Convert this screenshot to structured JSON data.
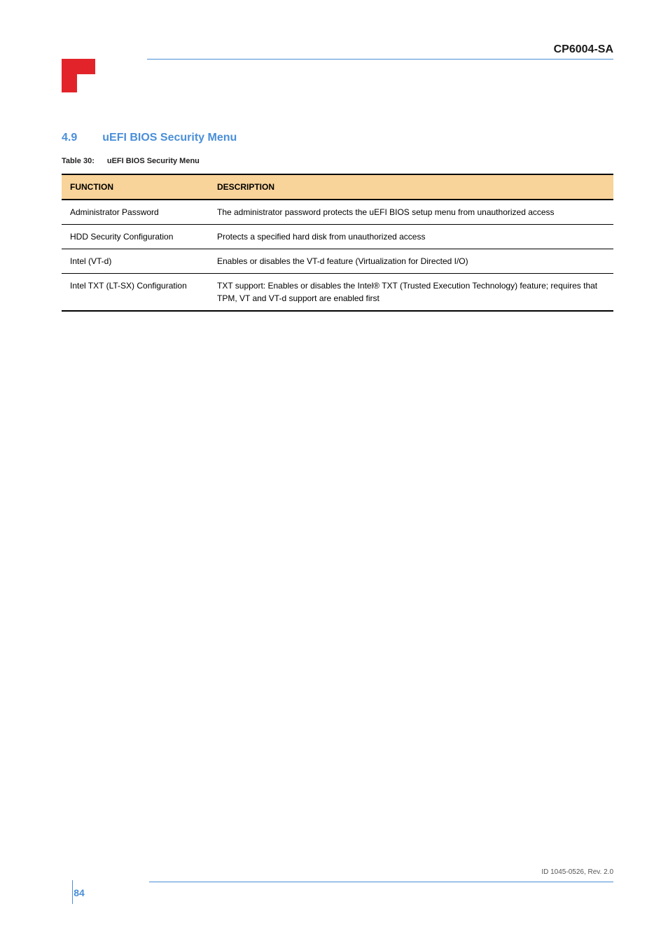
{
  "header": {
    "title": "CP6004-SA"
  },
  "section": {
    "number": "4.9",
    "title": "uEFI BIOS Security Menu"
  },
  "table": {
    "label": "Table 30:",
    "name": "uEFI BIOS Security Menu",
    "headers": [
      "FUNCTION",
      "DESCRIPTION"
    ],
    "rows": [
      {
        "function": "Administrator Password",
        "description": "The administrator password protects the uEFI BIOS setup menu from unauthorized access"
      },
      {
        "function": "HDD Security Configuration",
        "description": "Protects a specified hard disk from unauthorized access"
      },
      {
        "function": "Intel (VT-d)",
        "description": "Enables or disables the VT-d feature (Virtualization for Directed I/O)"
      },
      {
        "function": "Intel TXT (LT-SX) Configuration",
        "description": "TXT support: Enables or disables the Intel® TXT (Trusted Execution Technology) feature; requires that TPM, VT and VT-d support are enabled first"
      }
    ]
  },
  "footer": {
    "text": "ID 1045-0526, Rev. 2.0",
    "page": "84"
  }
}
